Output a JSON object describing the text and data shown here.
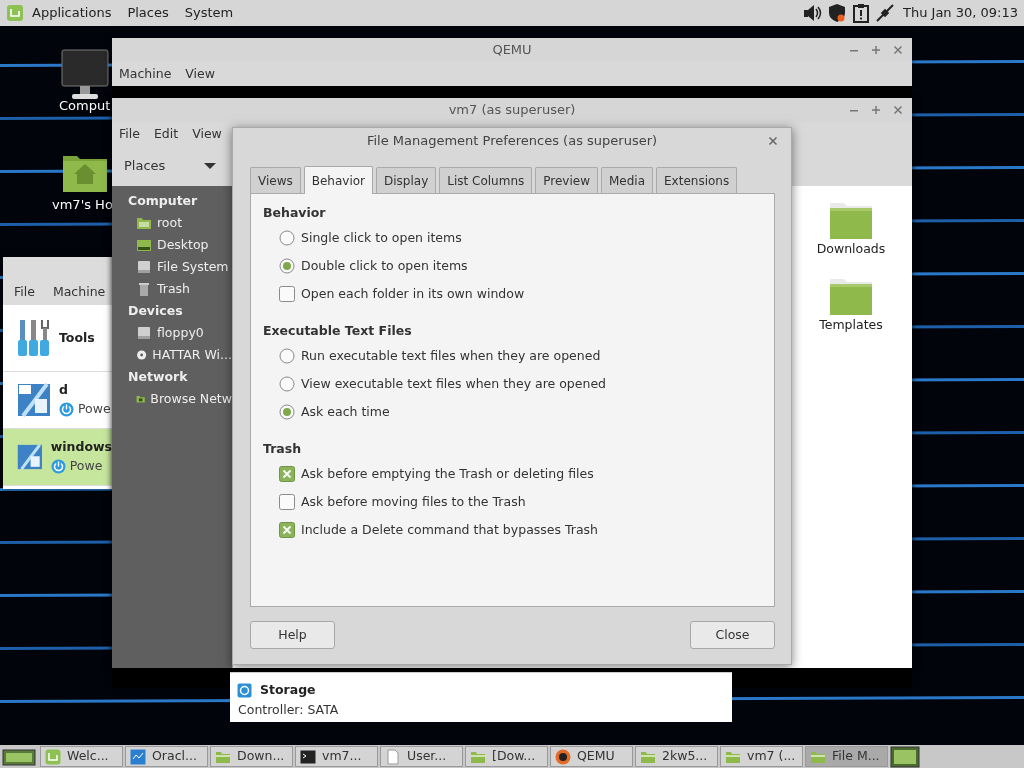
{
  "top_panel": {
    "menus": [
      "Applications",
      "Places",
      "System"
    ],
    "clock": "Thu Jan 30, 09:13"
  },
  "desktop_icons": [
    {
      "label": "Comput",
      "kind": "computer"
    },
    {
      "label": "vm7's Ho",
      "kind": "home"
    }
  ],
  "virtualbox": {
    "menus": [
      "File",
      "Machine"
    ],
    "machines": [
      {
        "name": "Tools",
        "kind": "tools",
        "selected": false
      },
      {
        "name": "d",
        "status": "Powe",
        "kind": "vm64",
        "selected": false
      },
      {
        "name": "windows",
        "status": "Powe",
        "kind": "vm",
        "selected": true
      }
    ],
    "details": {
      "section": "Storage",
      "line": "Controller: SATA"
    }
  },
  "qemu": {
    "title": "QEMU",
    "menus": [
      "Machine",
      "View"
    ]
  },
  "file_manager": {
    "title": "vm7 (as superuser)",
    "menus": [
      "File",
      "Edit",
      "View"
    ],
    "places": "Places",
    "sidebar": [
      {
        "heading": "Computer",
        "items": [
          {
            "label": "root",
            "kind": "folder"
          },
          {
            "label": "Desktop",
            "kind": "desktop"
          },
          {
            "label": "File System",
            "kind": "drive"
          },
          {
            "label": "Trash",
            "kind": "trash"
          }
        ]
      },
      {
        "heading": "Devices",
        "items": [
          {
            "label": "floppy0",
            "kind": "drive"
          },
          {
            "label": "HATTAR Wi...",
            "kind": "disc"
          }
        ]
      },
      {
        "heading": "Network",
        "items": [
          {
            "label": "Browse Netw",
            "kind": "network"
          }
        ]
      }
    ],
    "files": [
      {
        "label": "Downloads"
      },
      {
        "label": "Templates"
      }
    ]
  },
  "dialog": {
    "title": "File Management Preferences (as superuser)",
    "tabs": [
      {
        "label": "Views",
        "selected": false
      },
      {
        "label": "Behavior",
        "selected": true
      },
      {
        "label": "Display",
        "selected": false
      },
      {
        "label": "List Columns",
        "selected": false
      },
      {
        "label": "Preview",
        "selected": false
      },
      {
        "label": "Media",
        "selected": false
      },
      {
        "label": "Extensions",
        "selected": false
      }
    ],
    "sections": [
      {
        "heading": "Behavior",
        "options": [
          {
            "kind": "radio",
            "label": "Single click to open items",
            "checked": false
          },
          {
            "kind": "radio",
            "label": "Double click to open items",
            "checked": true
          },
          {
            "kind": "checkbox",
            "label": "Open each folder in its own window",
            "checked": false
          }
        ]
      },
      {
        "heading": "Executable Text Files",
        "options": [
          {
            "kind": "radio",
            "label": "Run executable text files when they are opened",
            "checked": false
          },
          {
            "kind": "radio",
            "label": "View executable text files when they are opened",
            "checked": false
          },
          {
            "kind": "radio",
            "label": "Ask each time",
            "checked": true
          }
        ]
      },
      {
        "heading": "Trash",
        "options": [
          {
            "kind": "checkbox",
            "label": "Ask before emptying the Trash or deleting files",
            "checked": true
          },
          {
            "kind": "checkbox",
            "label": "Ask before moving files to the Trash",
            "checked": false
          },
          {
            "kind": "checkbox",
            "label": "Include a Delete command that bypasses Trash",
            "checked": true
          }
        ]
      }
    ],
    "buttons": [
      "Help",
      "Close"
    ]
  },
  "taskbar": {
    "items": [
      {
        "label": "Welc...",
        "kind": "mint",
        "selected": false
      },
      {
        "label": "Oracl...",
        "kind": "monitor",
        "selected": false
      },
      {
        "label": "Down...",
        "kind": "folder",
        "selected": false
      },
      {
        "label": "vm7...",
        "kind": "terminal",
        "selected": false
      },
      {
        "label": "User...",
        "kind": "document",
        "selected": false
      },
      {
        "label": "[Dow...",
        "kind": "folder",
        "selected": false
      },
      {
        "label": "QEMU",
        "kind": "qemu",
        "selected": false
      },
      {
        "label": "2kw5...",
        "kind": "folder",
        "selected": false
      },
      {
        "label": "vm7 (...",
        "kind": "folder",
        "selected": false
      },
      {
        "label": "File M...",
        "kind": "folder",
        "selected": true
      }
    ]
  }
}
